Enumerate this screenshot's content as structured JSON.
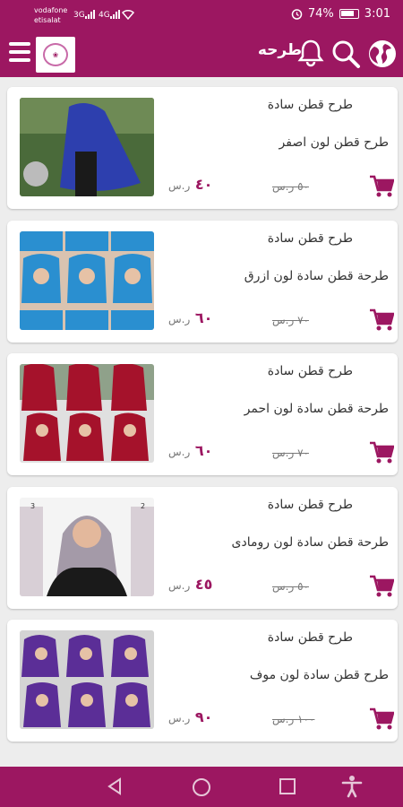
{
  "status_bar": {
    "carrier_1": "vodafone",
    "carrier_2": "etisalat",
    "network_1": "3G",
    "network_2": "4G",
    "battery": "74%",
    "time": "3:01"
  },
  "app_bar": {
    "title": "طرحه"
  },
  "products": [
    {
      "category": "طرح قطن سادة",
      "name": "طرح قطن لون اصفر",
      "old_price": "٥٠ ر.س",
      "price": "٤٠",
      "currency": "ر.س",
      "image_colors": [
        "#2d3fae",
        "#4a6a3a"
      ]
    },
    {
      "category": "طرح قطن سادة",
      "name": "طرحة قطن سادة لون ازرق",
      "old_price": "٧٠ ر.س",
      "price": "٦٠",
      "currency": "ر.س",
      "image_colors": [
        "#2a8fd0",
        "#d9c3b0"
      ]
    },
    {
      "category": "طرح قطن سادة",
      "name": "طرحة قطن سادة لون احمر",
      "old_price": "٧٠ ر.س",
      "price": "٦٠",
      "currency": "ر.س",
      "image_colors": [
        "#a5122b",
        "#cfcfcf"
      ]
    },
    {
      "category": "طرح قطن سادة",
      "name": "طرحة قطن سادة لون رومادى",
      "old_price": "٥٠ ر.س",
      "price": "٤٥",
      "currency": "ر.س",
      "image_colors": [
        "#a49aa8",
        "#1a1a1a"
      ]
    },
    {
      "category": "طرح قطن سادة",
      "name": "طرح قطن سادة لون موف",
      "old_price": "١٠٠ ر.س",
      "price": "٩٠",
      "currency": "ر.س",
      "image_colors": [
        "#5b2e97",
        "#d4d4d4"
      ]
    }
  ],
  "colors": {
    "brand": "#9c1761",
    "background": "#ededed"
  },
  "icons": [
    "menu-icon",
    "globe-icon",
    "search-icon",
    "bell-icon",
    "cart-icon",
    "back-icon",
    "home-icon",
    "recents-icon",
    "accessibility-icon"
  ]
}
